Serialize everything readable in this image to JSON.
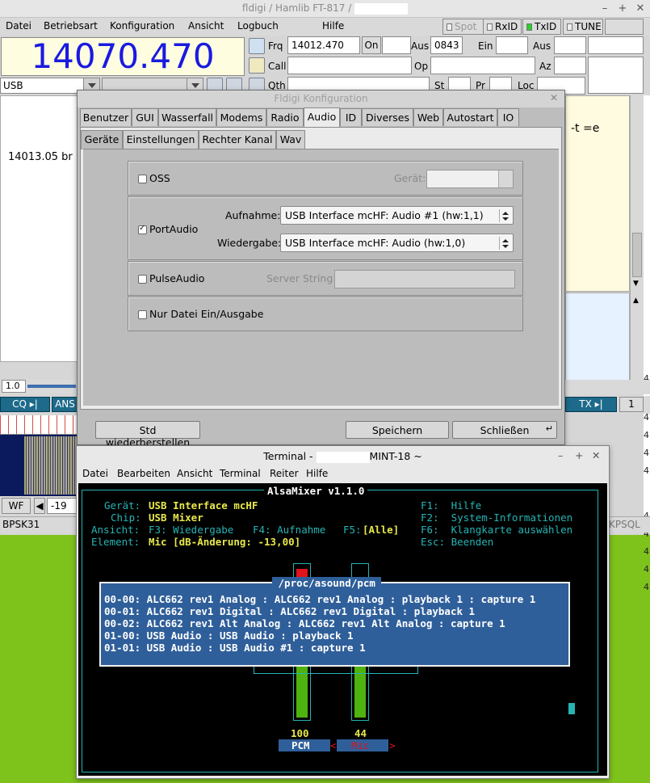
{
  "fldigi": {
    "title_prefix": "fldigi / Hamlib FT-817 /",
    "menu": [
      "Datei",
      "Betriebsart",
      "Konfiguration",
      "Ansicht",
      "Logbuch",
      "Hilfe"
    ],
    "toggles": {
      "spot": "Spot",
      "rxid": "RxID",
      "txid": "TxID",
      "tune": "TUNE"
    },
    "frequency": "14070.470",
    "mode": "USB",
    "labels": {
      "frq": "Frq",
      "on": "On",
      "aus": "Aus",
      "ein": "Ein",
      "call": "Call",
      "op": "Op",
      "az": "Az",
      "qth": "Qth",
      "st": "St",
      "pr": "Pr",
      "loc": "Loc"
    },
    "frq_value": "14012.470",
    "aus_value": "0843",
    "rx_line": "14013.05 br",
    "rx_right_text": "-t =e",
    "sig_value": "1.0",
    "macros": {
      "cq": "CQ ▸|",
      "ans": "ANS",
      "tx": "TX ▸|",
      "page": "1"
    },
    "wf": {
      "btn": "WF",
      "value": "-19"
    },
    "status_mode": "BPSK31",
    "status_right": "KPSQL",
    "edge_digits": [
      "4",
      "4",
      "4",
      "4",
      "4",
      "4",
      "4",
      "4",
      "4",
      "4"
    ]
  },
  "config": {
    "title": "Fldigi Konfiguration",
    "tabs": [
      "Benutzer",
      "GUI",
      "Wasserfall",
      "Modems",
      "Radio",
      "Audio",
      "ID",
      "Diverses",
      "Web",
      "Autostart",
      "IO"
    ],
    "active_tab": "Audio",
    "subtabs": [
      "Geräte",
      "Einstellungen",
      "Rechter Kanal",
      "Wav"
    ],
    "active_subtab": "Geräte",
    "oss": {
      "label": "OSS",
      "device_label": "Gerät:",
      "checked": false
    },
    "portaudio": {
      "label": "PortAudio",
      "checked": true,
      "capture_label": "Aufnahme:",
      "capture_value": "USB Interface mcHF: Audio #1 (hw:1,1)",
      "playback_label": "Wiedergabe:",
      "playback_value": "USB Interface mcHF: Audio (hw:1,0)"
    },
    "pulseaudio": {
      "label": "PulseAudio",
      "checked": false,
      "server_label": "Server String"
    },
    "file_only": {
      "label": "Nur Datei Ein/Ausgabe",
      "checked": false
    },
    "buttons": {
      "restore": "Std wiederherstellen",
      "save": "Speichern",
      "close": "Schließen"
    }
  },
  "terminal": {
    "title_prefix": "Terminal -",
    "title_suffix": "MINT-18 ~",
    "menu": [
      "Datei",
      "Bearbeiten",
      "Ansicht",
      "Terminal",
      "Reiter",
      "Hilfe"
    ],
    "mixer_title": "AlsaMixer v1.1.0",
    "device_label": "Gerät:",
    "device_value": "USB Interface mcHF",
    "chip_label": "Chip:",
    "chip_value": "USB Mixer",
    "view_label": "Ansicht:",
    "view_f3": "F3: Wiedergabe",
    "view_f4": "F4: Aufnahme",
    "view_f5": "F5:",
    "view_f5_value": "[Alle]",
    "element_label": "Element:",
    "element_value": "Mic [dB-Änderung: -13,00]",
    "keys": [
      "F1:  Hilfe",
      "F2:  System-Informationen",
      "F6:  Klangkarte auswählen",
      "Esc: Beenden"
    ],
    "popup_title": " /proc/asound/pcm ",
    "popup_lines": [
      "00-00: ALC662 rev1 Analog : ALC662 rev1 Analog : playback 1 : capture 1",
      "00-01: ALC662 rev1 Digital : ALC662 rev1 Digital : playback 1",
      "00-02: ALC662 rev1 Alt Analog : ALC662 rev1 Alt Analog : capture 1",
      "01-00: USB Audio : USB Audio : playback 1",
      "01-01: USB Audio : USB Audio #1 : capture 1"
    ],
    "pcm_level": "100",
    "mic_level": "44",
    "pcm_label": "PCM",
    "mic_label": "Mic",
    "pcm_fill": 1.0,
    "mic_fill": 0.44
  },
  "colors": {
    "freq": "#1a1ae0",
    "macro": "#1d6a8a",
    "txid_led": "#26d22a",
    "desktop": "#7ec21c",
    "term_cyan": "#27b3b3",
    "term_yellow": "#e8e84a",
    "popup_blue": "#2f5f9a",
    "bar_green": "#4fb30f",
    "bar_red": "#e0141a"
  }
}
